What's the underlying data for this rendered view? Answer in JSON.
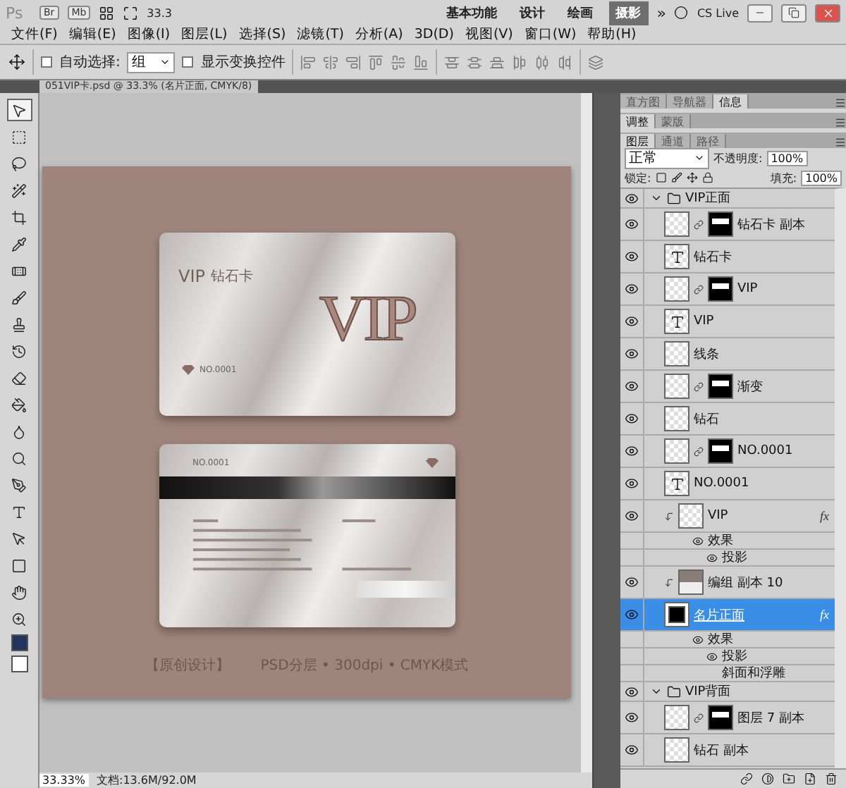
{
  "app_bar": {
    "logo": "Ps",
    "bridge": "Br",
    "mini_bridge": "Mb",
    "zoom": "33.3",
    "workspaces": [
      {
        "label": "基本功能",
        "selected": false
      },
      {
        "label": "设计",
        "selected": false
      },
      {
        "label": "绘画",
        "selected": false
      },
      {
        "label": "摄影",
        "selected": true
      }
    ],
    "more": "»",
    "cs_live": "CS Live"
  },
  "menu": [
    "文件(F)",
    "编辑(E)",
    "图像(I)",
    "图层(L)",
    "选择(S)",
    "滤镜(T)",
    "分析(A)",
    "3D(D)",
    "视图(V)",
    "窗口(W)",
    "帮助(H)"
  ],
  "options_bar": {
    "auto_select": {
      "label": "自动选择:",
      "checked": false
    },
    "auto_select_target": "组",
    "show_transform": {
      "label": "显示变换控件",
      "checked": false
    }
  },
  "document_tab": {
    "title": "051VIP卡.psd @ 33.3% (名片正面, CMYK/8)"
  },
  "tools": [
    {
      "selected": true
    },
    {
      "selected": false
    },
    {
      "selected": false
    },
    {
      "selected": false
    },
    {
      "selected": false
    },
    {
      "selected": false
    },
    {
      "selected": false
    },
    {
      "selected": false
    },
    {
      "selected": false
    },
    {
      "selected": false
    },
    {
      "selected": false
    },
    {
      "selected": false
    },
    {
      "selected": false
    },
    {
      "selected": false
    },
    {
      "selected": false
    },
    {
      "selected": false
    },
    {
      "selected": false
    },
    {
      "selected": false
    },
    {
      "selected": false
    },
    {
      "selected": false
    }
  ],
  "document": {
    "front_card": {
      "brand": "VIP",
      "title": "钻石卡",
      "emblem": "VIP",
      "number": "NO.0001"
    },
    "back_card": {
      "number": "NO.0001"
    },
    "caption": [
      "【原创设计】",
      "PSD分层 • 300dpi • CMYK模式"
    ]
  },
  "status_bar": {
    "zoom": "33.33%",
    "doc_info": "文档:13.6M/92.0M"
  },
  "panels": {
    "info_tabs": [
      {
        "label": "直方图",
        "selected": false
      },
      {
        "label": "导航器",
        "selected": false
      },
      {
        "label": "信息",
        "selected": true
      }
    ],
    "adjust_tabs": [
      {
        "label": "调整",
        "selected": true
      },
      {
        "label": "蒙版",
        "selected": false
      }
    ],
    "layer_tabs": [
      {
        "label": "图层",
        "selected": true
      },
      {
        "label": "通道",
        "selected": false
      },
      {
        "label": "路径",
        "selected": false
      }
    ],
    "blend_mode": "正常",
    "opacity_label": "不透明度:",
    "opacity": "100%",
    "lock_label": "锁定:",
    "fill_label": "填充:",
    "fill": "100%",
    "layers": [
      {
        "kind": "group",
        "name": "VIP正面",
        "visible": true,
        "expanded": true,
        "children": [
          {
            "kind": "pixel",
            "mask": true,
            "name": "钻石卡 副本",
            "visible": true,
            "selected": false
          },
          {
            "kind": "text",
            "name": "钻石卡",
            "visible": true,
            "selected": false
          },
          {
            "kind": "pixel",
            "mask": true,
            "name": "VIP",
            "visible": true,
            "selected": false
          },
          {
            "kind": "text",
            "name": "VIP",
            "visible": true,
            "selected": false
          },
          {
            "kind": "pixel",
            "mask": false,
            "name": "线条",
            "visible": true,
            "selected": false
          },
          {
            "kind": "pixel",
            "mask": true,
            "name": "渐变",
            "visible": true,
            "selected": false
          },
          {
            "kind": "pixel",
            "mask": false,
            "name": "钻石",
            "visible": true,
            "selected": false
          },
          {
            "kind": "pixel",
            "mask": true,
            "name": "NO.0001",
            "visible": true,
            "selected": false
          },
          {
            "kind": "text",
            "name": "NO.0001",
            "visible": true,
            "selected": false
          },
          {
            "kind": "pixel",
            "mask": false,
            "clipped": true,
            "name": "VIP",
            "fx": "fx",
            "visible": true,
            "selected": false,
            "effects_label": "效果",
            "effects": [
              {
                "name": "投影",
                "visible": true
              }
            ]
          },
          {
            "kind": "photo",
            "clipped": true,
            "name": "编组 副本 10",
            "visible": true,
            "selected": false
          },
          {
            "kind": "shape",
            "name": "名片正面",
            "fx": "fx",
            "visible": true,
            "selected": true,
            "effects_label": "效果",
            "effects": [
              {
                "name": "投影",
                "visible": true
              },
              {
                "name": "斜面和浮雕",
                "visible": false
              }
            ]
          }
        ]
      },
      {
        "kind": "group",
        "name": "VIP背面",
        "visible": true,
        "expanded": true,
        "children": [
          {
            "kind": "pixel",
            "mask": true,
            "name": "图层 7 副本",
            "visible": true,
            "selected": false
          },
          {
            "kind": "pixel",
            "mask": false,
            "name": "钻石 副本",
            "visible": true,
            "selected": false
          }
        ]
      }
    ]
  }
}
